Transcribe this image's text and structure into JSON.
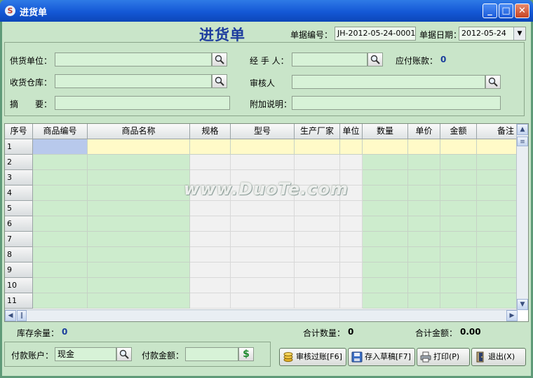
{
  "window": {
    "title": "进货单",
    "minimize": "_",
    "maximize": "□",
    "close": "✕"
  },
  "header": {
    "big_title": "进货单",
    "doc_no_label": "单据编号：",
    "doc_no_value": "JH-2012-05-24-0001",
    "doc_date_label": "单据日期：",
    "doc_date_value": "2012-05-24"
  },
  "form": {
    "supplier_label": "供货单位：",
    "supplier_value": "",
    "warehouse_label": "收货仓库：",
    "warehouse_value": "",
    "summary_label": "摘　　要：",
    "summary_value": "",
    "handler_label": "经 手 人：",
    "handler_value": "",
    "payable_label": "应付账款：",
    "payable_value": "0",
    "reviewer_label": "审核人",
    "reviewer_value": "",
    "note_label": "附加说明：",
    "note_value": ""
  },
  "grid": {
    "columns": [
      "序号",
      "商品编号",
      "商品名称",
      "规格",
      "型号",
      "生产厂家",
      "单位",
      "数量",
      "单价",
      "金额",
      "备注"
    ],
    "rows": [
      "1",
      "2",
      "3",
      "4",
      "5",
      "6",
      "7",
      "8",
      "9",
      "10",
      "11"
    ]
  },
  "watermark": "www.DuoTe.com",
  "totals": {
    "stock_label": "库存余量：",
    "stock_value": "0",
    "qty_label": "合计数量：",
    "qty_value": "0",
    "amount_label": "合计金额：",
    "amount_value": "0.00"
  },
  "payment": {
    "account_label": "付款账户：",
    "account_value": "现金",
    "amount_label": "付款金额：",
    "amount_value": ""
  },
  "buttons": {
    "approve": "审核过账[F6]",
    "draft": "存入草稿[F7]",
    "print": "打印(P)",
    "exit": "退出(X)"
  }
}
